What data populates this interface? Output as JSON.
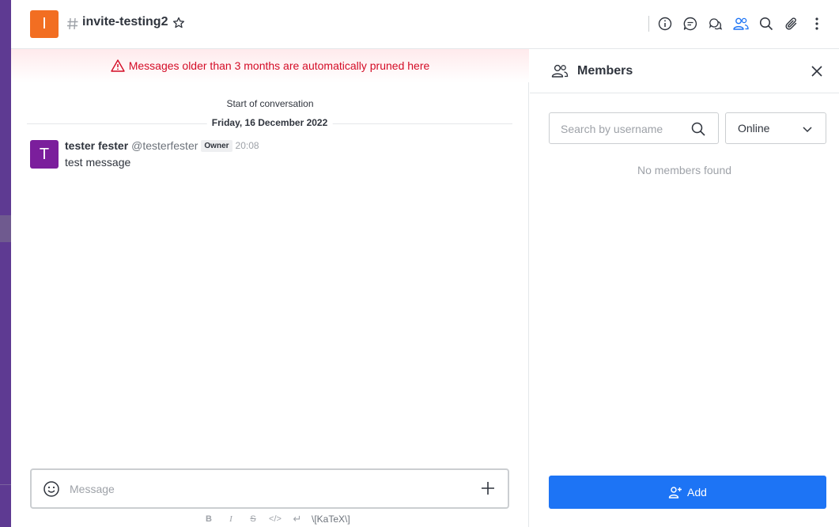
{
  "header": {
    "room_avatar_letter": "I",
    "room_name": "invite-testing2",
    "icons": [
      "room-info-icon",
      "discussion-icon",
      "threads-icon",
      "members-icon",
      "search-icon",
      "files-icon",
      "kebab-menu-icon"
    ]
  },
  "main": {
    "prune_warning": "Messages older than 3 months are automatically pruned here",
    "start_of_conversation": "Start of conversation",
    "day_divider": "Friday, 16 December 2022",
    "message": {
      "avatar_letter": "T",
      "author": "tester fester",
      "username": "@testerfester",
      "role": "Owner",
      "time": "20:08",
      "text": "test message"
    },
    "composer": {
      "placeholder": "Message"
    },
    "format_bar": {
      "bold": "B",
      "italic": "I",
      "strike": "S",
      "code": "</>",
      "multiline": "↵",
      "katex": "\\[KaTeX\\]"
    }
  },
  "members_panel": {
    "title": "Members",
    "search_placeholder": "Search by username",
    "status_value": "Online",
    "empty_text": "No members found",
    "add_label": "Add"
  },
  "colors": {
    "sidebar": "#5e3a92",
    "room_avatar": "#f26e22",
    "user_avatar": "#7b1e9c",
    "warning": "#d40c26",
    "primary": "#1d74f5"
  }
}
